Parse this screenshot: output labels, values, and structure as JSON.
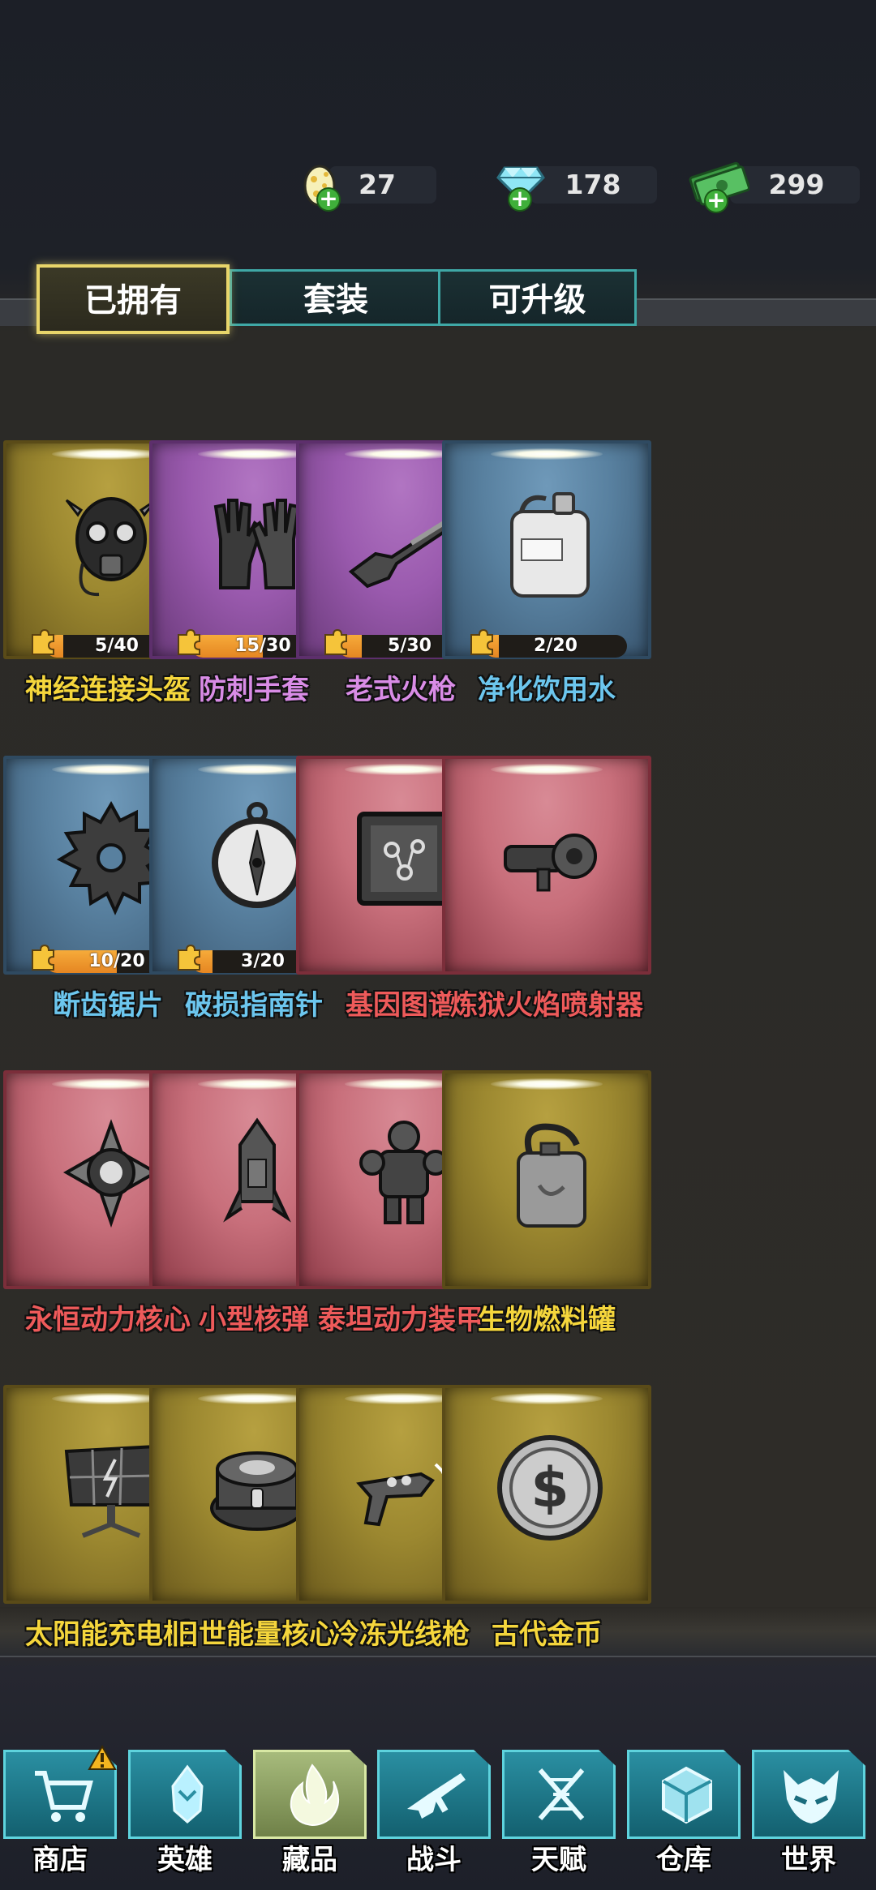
{
  "currencies": [
    {
      "id": "eggs",
      "icon": "egg-icon",
      "value": "27"
    },
    {
      "id": "diamonds",
      "icon": "diamond-icon",
      "value": "178"
    },
    {
      "id": "cash",
      "icon": "cash-icon",
      "value": "299"
    }
  ],
  "tabs": [
    {
      "label": "已拥有",
      "active": true
    },
    {
      "label": "套装",
      "active": false
    },
    {
      "label": "可升级",
      "active": false
    }
  ],
  "items": [
    {
      "name": "神经连接头盔",
      "rarity": "gold",
      "icon": "helmet-icon",
      "progress": "5/40",
      "fraction": 0.125,
      "name_color": "#f5d63c"
    },
    {
      "name": "防刺手套",
      "rarity": "purple",
      "icon": "gloves-icon",
      "progress": "15/30",
      "fraction": 0.5,
      "name_color": "#d98ce6"
    },
    {
      "name": "老式火枪",
      "rarity": "purple",
      "icon": "musket-icon",
      "progress": "5/30",
      "fraction": 0.1667,
      "name_color": "#d98ce6"
    },
    {
      "name": "净化饮用水",
      "rarity": "blue",
      "icon": "water-jug-icon",
      "progress": "2/20",
      "fraction": 0.1,
      "name_color": "#6cc6ee"
    },
    {
      "name": "断齿锯片",
      "rarity": "blue",
      "icon": "saw-blade-icon",
      "progress": "10/20",
      "fraction": 0.5,
      "name_color": "#6cc6ee"
    },
    {
      "name": "破损指南针",
      "rarity": "blue",
      "icon": "compass-icon",
      "progress": "3/20",
      "fraction": 0.15,
      "name_color": "#6cc6ee"
    },
    {
      "name": "基因图谱",
      "rarity": "red",
      "icon": "gene-map-icon",
      "progress": "",
      "fraction": 0,
      "name_color": "#ee5a5a"
    },
    {
      "name": "炼狱火焰喷射器",
      "rarity": "red",
      "icon": "flamethrower-icon",
      "progress": "",
      "fraction": 0,
      "name_color": "#ee5a5a"
    },
    {
      "name": "永恒动力核心",
      "rarity": "red",
      "icon": "power-core-icon",
      "progress": "",
      "fraction": 0,
      "name_color": "#ee5a5a"
    },
    {
      "name": "小型核弹",
      "rarity": "red",
      "icon": "nuke-icon",
      "progress": "",
      "fraction": 0,
      "name_color": "#ee5a5a"
    },
    {
      "name": "泰坦动力装甲",
      "rarity": "red",
      "icon": "power-armor-icon",
      "progress": "",
      "fraction": 0,
      "name_color": "#ee5a5a"
    },
    {
      "name": "生物燃料罐",
      "rarity": "gold",
      "icon": "fuel-can-icon",
      "progress": "",
      "fraction": 0,
      "name_color": "#f5d63c"
    },
    {
      "name": "太阳能充电板",
      "rarity": "gold",
      "icon": "solar-panel-icon",
      "progress": "",
      "fraction": 0,
      "name_color": "#f5d63c"
    },
    {
      "name": "旧世能量核心",
      "rarity": "gold",
      "icon": "energy-core-icon",
      "progress": "",
      "fraction": 0,
      "name_color": "#f5d63c"
    },
    {
      "name": "冷冻光线枪",
      "rarity": "gold",
      "icon": "ray-gun-icon",
      "progress": "",
      "fraction": 0,
      "name_color": "#f5d63c"
    },
    {
      "name": "古代金币",
      "rarity": "gold",
      "icon": "coin-icon",
      "progress": "",
      "fraction": 0,
      "name_color": "#f5d63c"
    }
  ],
  "nav": [
    {
      "label": "商店",
      "icon": "cart-icon",
      "alert": true,
      "active": false
    },
    {
      "label": "英雄",
      "icon": "hero-icon",
      "alert": false,
      "active": false
    },
    {
      "label": "藏品",
      "icon": "flame-icon",
      "alert": false,
      "active": true
    },
    {
      "label": "战斗",
      "icon": "rifle-icon",
      "alert": false,
      "active": false
    },
    {
      "label": "天赋",
      "icon": "dna-icon",
      "alert": false,
      "active": false
    },
    {
      "label": "仓库",
      "icon": "crate-icon",
      "alert": false,
      "active": false
    },
    {
      "label": "世界",
      "icon": "demon-mask-icon",
      "alert": false,
      "active": false
    }
  ],
  "colors": {
    "gold_text": "#f5d63c",
    "purple_text": "#d98ce6",
    "blue_text": "#6cc6ee",
    "red_text": "#ee5a5a",
    "progress_fill": "#f09a2c",
    "tab_active_border": "#e8d56a",
    "tab_border": "#3fa8a6"
  }
}
